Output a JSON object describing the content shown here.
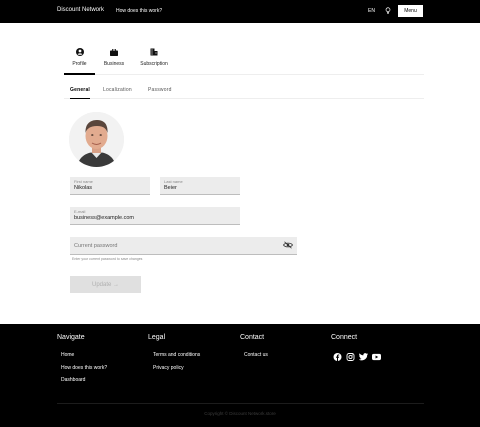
{
  "header": {
    "brand": "Discount Network",
    "how_link": "How does this work?",
    "lang": "EN",
    "menu_label": "Menu"
  },
  "tabs": [
    {
      "label": "Profile",
      "icon": "profile-icon",
      "active": true
    },
    {
      "label": "Business",
      "icon": "briefcase-icon",
      "active": false
    },
    {
      "label": "Subscription",
      "icon": "subscription-icon",
      "active": false
    }
  ],
  "subtabs": [
    {
      "label": "General",
      "active": true
    },
    {
      "label": "Localization",
      "active": false
    },
    {
      "label": "Password",
      "active": false
    }
  ],
  "form": {
    "first_name_label": "First name",
    "first_name_value": "Nikolas",
    "last_name_label": "Last name",
    "last_name_value": "Beier",
    "email_label": "E-mail",
    "email_value": "business@example.com",
    "current_password_placeholder": "Current password",
    "hint": "Enter your current password to save changes",
    "update_label": "Update →"
  },
  "footer": {
    "navigate": {
      "title": "Navigate",
      "links": [
        "Home",
        "How does this work?",
        "Dashboard"
      ]
    },
    "legal": {
      "title": "Legal",
      "links": [
        "Terms and conditions",
        "Privacy policy"
      ]
    },
    "contact": {
      "title": "Contact",
      "links": [
        "Contact us"
      ]
    },
    "connect": {
      "title": "Connect",
      "icons": [
        "facebook-icon",
        "instagram-icon",
        "twitter-icon",
        "youtube-icon"
      ]
    },
    "copyright": "Copyright © Discount Network.store"
  },
  "colors": {
    "header_bg": "#000000",
    "footer_bg": "#000000",
    "field_bg": "#ececec",
    "button_disabled_bg": "#e0e0e0"
  }
}
